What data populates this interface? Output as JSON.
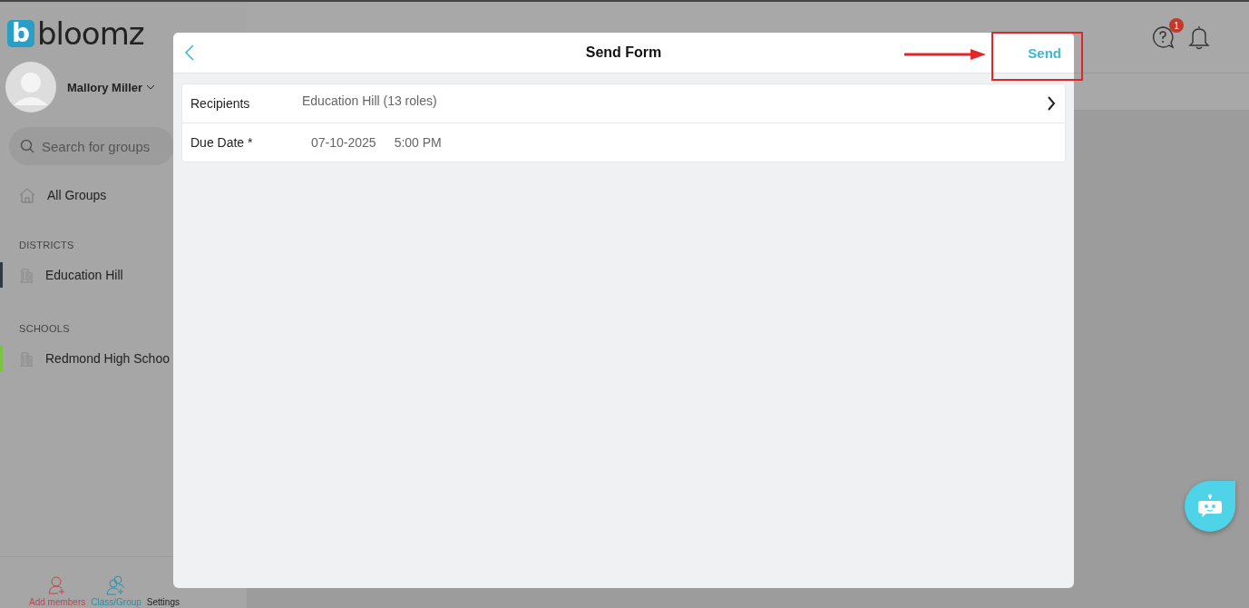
{
  "sidebar": {
    "logo_mark": "b",
    "logo_text": "bloomz",
    "user": {
      "name": "Mallory Miller"
    },
    "search": {
      "placeholder": "Search for groups"
    },
    "all_groups": "All Groups",
    "sections": [
      {
        "title": "DISTRICTS",
        "items": [
          {
            "label": "Education Hill",
            "color": "#2f3a40"
          }
        ]
      },
      {
        "title": "SCHOOLS",
        "items": [
          {
            "label": "Redmond High Schoo",
            "color": "#7cc243"
          }
        ]
      }
    ],
    "bottom_actions": [
      {
        "kind": "add-member",
        "label": "Add members"
      },
      {
        "kind": "class-group",
        "label": "Class/Group"
      },
      {
        "kind": "settings",
        "label": "Settings"
      }
    ]
  },
  "header": {
    "help_badge": "1"
  },
  "modal": {
    "title": "Send Form",
    "action": "Send",
    "rows": [
      {
        "label": "Recipients",
        "values": [
          "Education Hill (13 roles)"
        ],
        "has_chevron": true
      },
      {
        "label": "Due Date *",
        "values": [
          "07-10-2025",
          "5:00 PM"
        ],
        "has_chevron": false
      }
    ]
  }
}
